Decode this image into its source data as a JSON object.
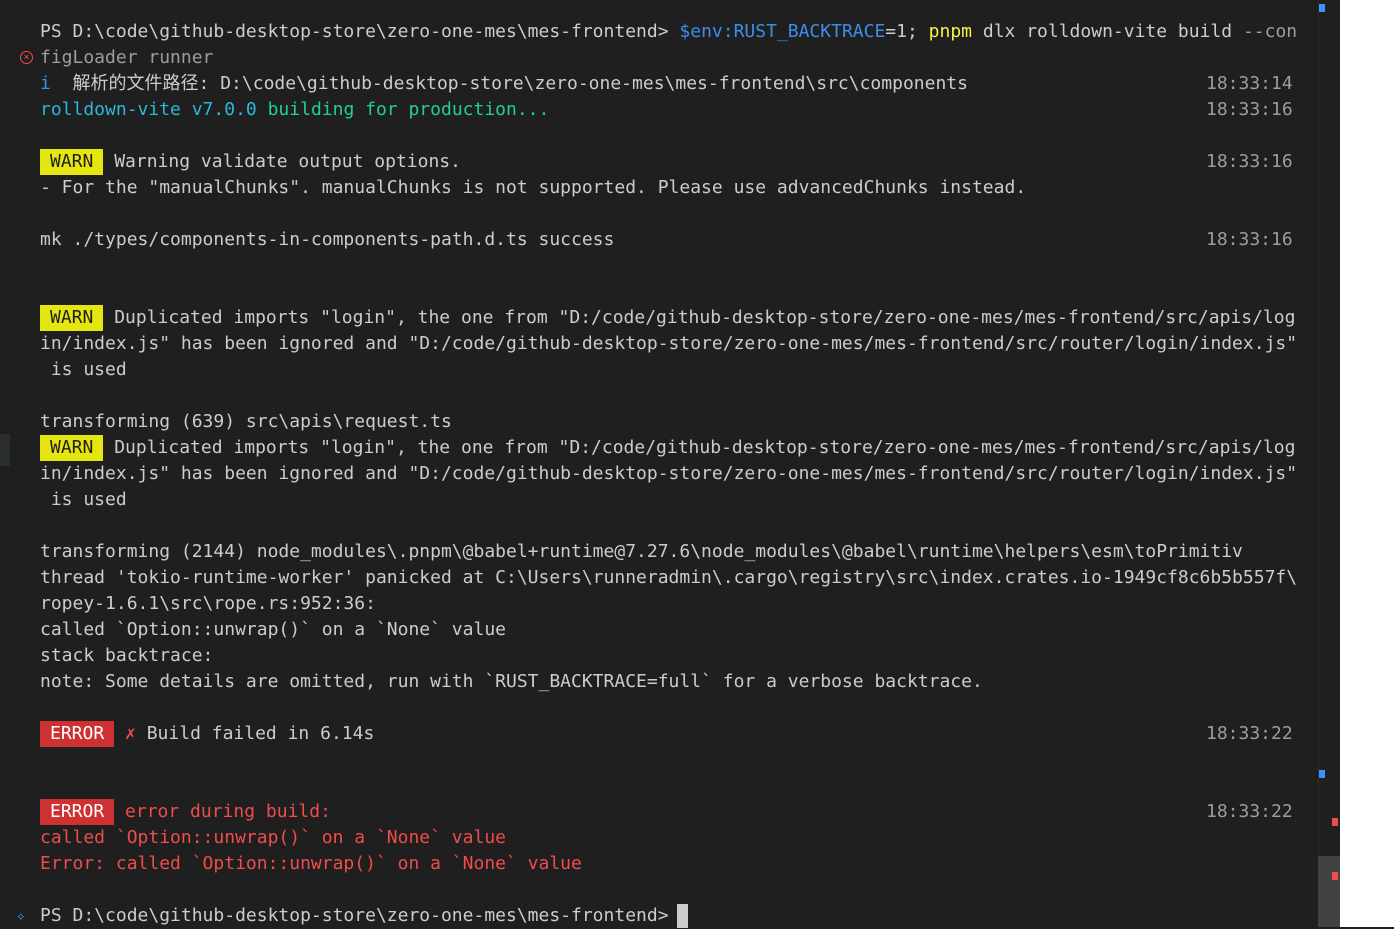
{
  "terminal": {
    "command": {
      "prompt": "PS D:\\code\\github-desktop-store\\zero-one-mes\\mes-frontend>",
      "env_var": "$env:RUST_BACKTRACE",
      "env_value": "=1;",
      "exe": "pnpm",
      "args": "dlx rolldown-vite build",
      "flag": "--con",
      "wrap": "figLoader runner"
    },
    "path_info": {
      "prefix": "i",
      "label": "解析的文件路径:",
      "path": "D:\\code\\github-desktop-store\\zero-one-mes\\mes-frontend\\src\\components",
      "time": "18:33:14"
    },
    "build_start": {
      "tool": "rolldown-vite v7.0.0",
      "text": "building for production...",
      "time": "18:33:16"
    },
    "warn1": {
      "badge": "WARN",
      "text": "Warning validate output options.",
      "time": "18:33:16",
      "detail": "- For the \"manualChunks\". manualChunks is not supported. Please use advancedChunks instead."
    },
    "mk": {
      "text": "mk ./types/components-in-components-path.d.ts success",
      "time": "18:33:16"
    },
    "warn2": {
      "badge": "WARN",
      "line1": "Duplicated imports \"login\", the one from \"D:/code/github-desktop-store/zero-one-mes/mes-frontend/src/apis/log",
      "line2": "in/index.js\" has been ignored and \"D:/code/github-desktop-store/zero-one-mes/mes-frontend/src/router/login/index.js\"",
      "line3": " is used"
    },
    "transform1": "transforming (639) src\\apis\\request.ts",
    "warn3": {
      "badge": "WARN",
      "line1": "Duplicated imports \"login\", the one from \"D:/code/github-desktop-store/zero-one-mes/mes-frontend/src/apis/log",
      "line2": "in/index.js\" has been ignored and \"D:/code/github-desktop-store/zero-one-mes/mes-frontend/src/router/login/index.js\"",
      "line3": " is used"
    },
    "panic": {
      "transform2": "transforming (2144) node_modules\\.pnpm\\@babel+runtime@7.27.6\\node_modules\\@babel\\runtime\\helpers\\esm\\toPrimitiv",
      "line1": "thread 'tokio-runtime-worker' panicked at C:\\Users\\runneradmin\\.cargo\\registry\\src\\index.crates.io-1949cf8c6b5b557f\\",
      "line2": "ropey-1.6.1\\src\\rope.rs:952:36:",
      "line3": "called `Option::unwrap()` on a `None` value",
      "line4": "stack backtrace:",
      "line5": "note: Some details are omitted, run with `RUST_BACKTRACE=full` for a verbose backtrace."
    },
    "error1": {
      "badge": "ERROR",
      "mark": "✗",
      "text": "Build failed in 6.14s",
      "time": "18:33:22"
    },
    "error2": {
      "badge": "ERROR",
      "text": "error during build:",
      "time": "18:33:22",
      "line1": "called `Option::unwrap()` on a `None` value",
      "line2": "Error: called `Option::unwrap()` on a `None` value"
    },
    "final_prompt": "PS D:\\code\\github-desktop-store\\zero-one-mes\\mes-frontend>"
  },
  "colors": {
    "background": "#1f1f1f",
    "warn_badge": "#e5e510",
    "error_badge": "#cd3131",
    "error_text": "#f14c4c",
    "accent_blue": "#3b8eea",
    "cyan": "#29b8db",
    "green": "#23d18b"
  },
  "icons": {
    "gutter_error": "error-circle-icon",
    "gutter_sparkle": "sparkle-icon"
  }
}
